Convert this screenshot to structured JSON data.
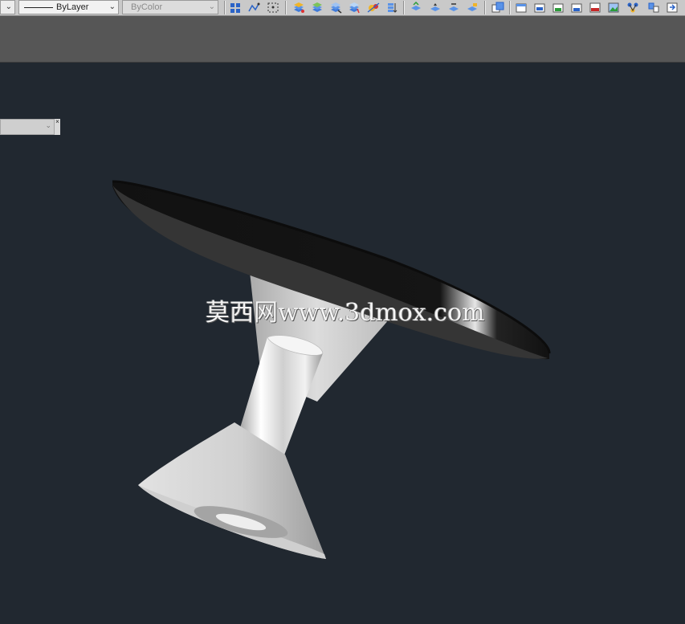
{
  "toolbar": {
    "linetype": {
      "value": "ByLayer"
    },
    "color": {
      "value": "ByColor"
    },
    "icons": [
      "layout-grid-icon",
      "polyline-icon",
      "select-region-icon",
      "layer-properties-icon",
      "layer-state-icon",
      "layer-isolate-icon",
      "layer-freeze-icon",
      "layer-walk-icon",
      "layer-merge-icon",
      "layer-previous-icon",
      "layer-lock-icon",
      "layer-unlock-icon",
      "layer-match-icon",
      "publish-icon",
      "new-sheet-icon",
      "open-sheet-icon",
      "save-sheet-icon",
      "dwf-export-icon",
      "pdf-export-icon",
      "image-export-icon",
      "network-icon",
      "transfer-icon",
      "import-icon"
    ]
  },
  "viewport": {
    "background": "#212830",
    "watermark": "莫西网www.3dmox.com",
    "floating_combo": {
      "value": ""
    }
  },
  "colors": {
    "toolbar": "#c9c9c9",
    "ribbon_band": "#565656",
    "viewport": "#212830",
    "tabletop": "#353535",
    "pedestal": "#c8c8c8"
  }
}
